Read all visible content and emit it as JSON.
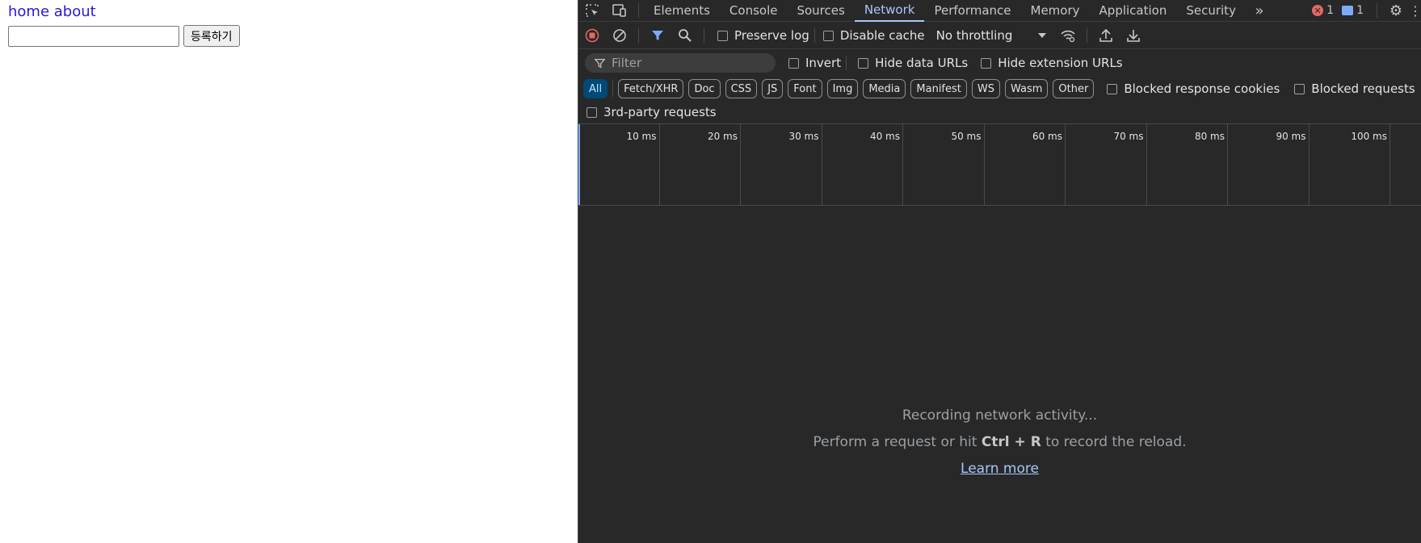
{
  "page": {
    "nav_home": "home",
    "nav_about": "about",
    "input_value": "",
    "submit_label": "등록하기"
  },
  "devtools": {
    "tabs": [
      "Elements",
      "Console",
      "Sources",
      "Network",
      "Performance",
      "Memory",
      "Application",
      "Security"
    ],
    "active_tab": "Network",
    "error_count": "1",
    "message_count": "1",
    "toolbar": {
      "preserve_log": "Preserve log",
      "disable_cache": "Disable cache",
      "throttling": "No throttling"
    },
    "filter": {
      "placeholder": "Filter",
      "invert": "Invert",
      "hide_data_urls": "Hide data URLs",
      "hide_extension_urls": "Hide extension URLs"
    },
    "types": [
      "All",
      "Fetch/XHR",
      "Doc",
      "CSS",
      "JS",
      "Font",
      "Img",
      "Media",
      "Manifest",
      "WS",
      "Wasm",
      "Other"
    ],
    "blocked_response_cookies": "Blocked response cookies",
    "blocked_requests": "Blocked requests",
    "third_party": "3rd-party requests",
    "timeline_ticks": [
      "10 ms",
      "20 ms",
      "30 ms",
      "40 ms",
      "50 ms",
      "60 ms",
      "70 ms",
      "80 ms",
      "90 ms",
      "100 ms"
    ],
    "empty": {
      "recording": "Recording network activity...",
      "hint_before": "Perform a request or hit ",
      "hint_key": "Ctrl + R",
      "hint_after": " to record the reload.",
      "learn_more": "Learn more"
    },
    "colors": {
      "accent": "#a8c7fa",
      "error": "#e46962",
      "record": "#e46962",
      "background": "#282828"
    }
  }
}
